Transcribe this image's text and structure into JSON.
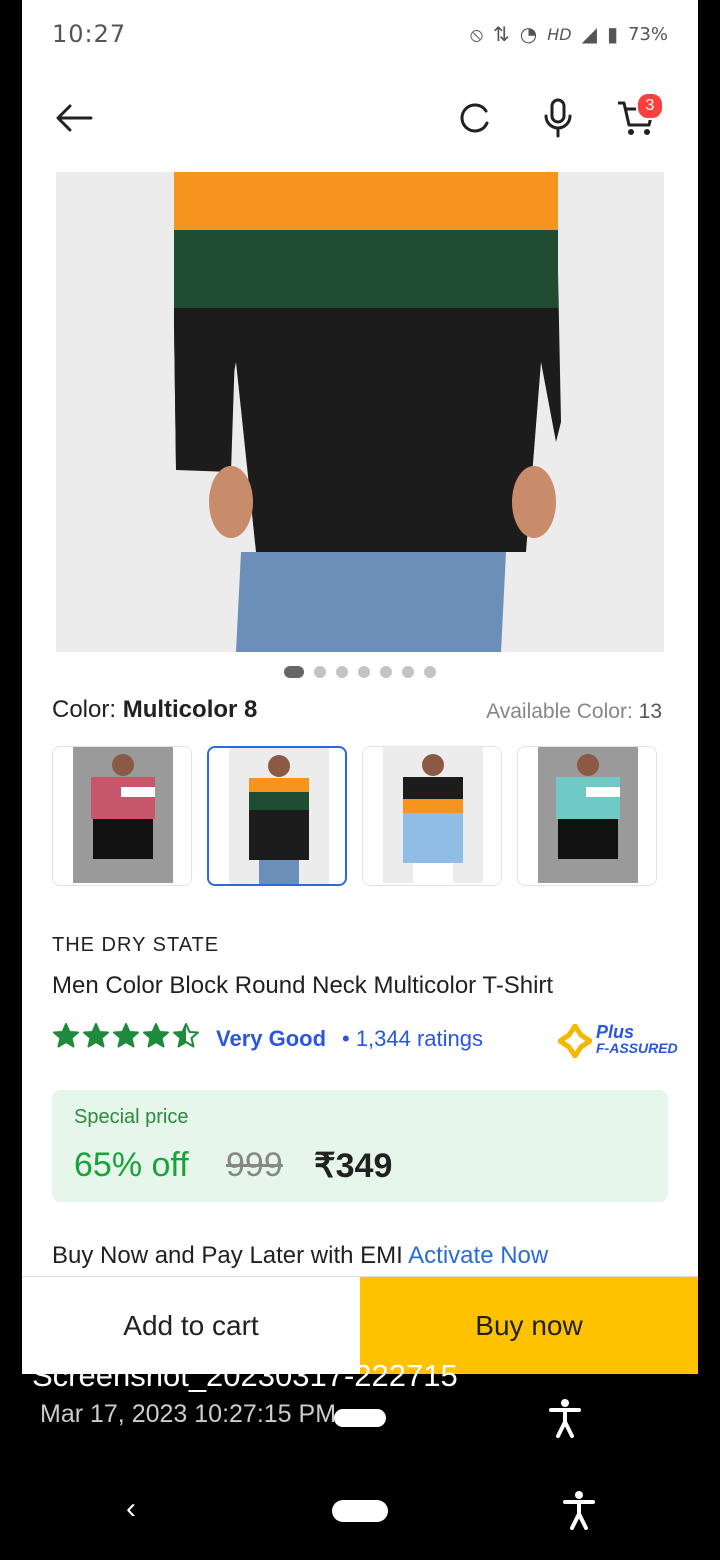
{
  "status_bar": {
    "time": "10:27",
    "network": "HD",
    "battery": "73%"
  },
  "header": {
    "cart_count": "3"
  },
  "gallery": {
    "dots": 7,
    "active_index": 0
  },
  "color": {
    "label": "Color:",
    "value": "Multicolor 8",
    "available_label": "Available Color:",
    "available_count": "13"
  },
  "swatches": [
    {
      "name": "pink-white",
      "selected": false
    },
    {
      "name": "orange-green-black",
      "selected": true
    },
    {
      "name": "black-orange-blue",
      "selected": false
    },
    {
      "name": "teal-white",
      "selected": false
    }
  ],
  "product": {
    "brand": "THE DRY STATE",
    "title": "Men Color Block Round Neck Multicolor T-Shirt",
    "rating_stars": 4.5,
    "rating_label": "Very Good",
    "ratings_count": "• 1,344 ratings",
    "plus_line1": "Plus",
    "plus_line2": "F-ASSURED"
  },
  "price": {
    "special_label": "Special price",
    "discount": "65% off",
    "mrp": "999",
    "final": "₹349"
  },
  "emi": {
    "text": "Buy Now and Pay Later with EMI",
    "link": "Activate Now"
  },
  "actions": {
    "add_to_cart": "Add to cart",
    "buy_now": "Buy now"
  },
  "screenshot_overlay": {
    "filename": "Screenshot_20230317-222715",
    "timestamp": "Mar 17, 2023 10:27:15 PM"
  },
  "colors": {
    "accent_blue": "#2a6cd6",
    "buy_yellow": "#ffc200",
    "price_green": "#19a33a",
    "badge_red": "#ff3e3e"
  }
}
